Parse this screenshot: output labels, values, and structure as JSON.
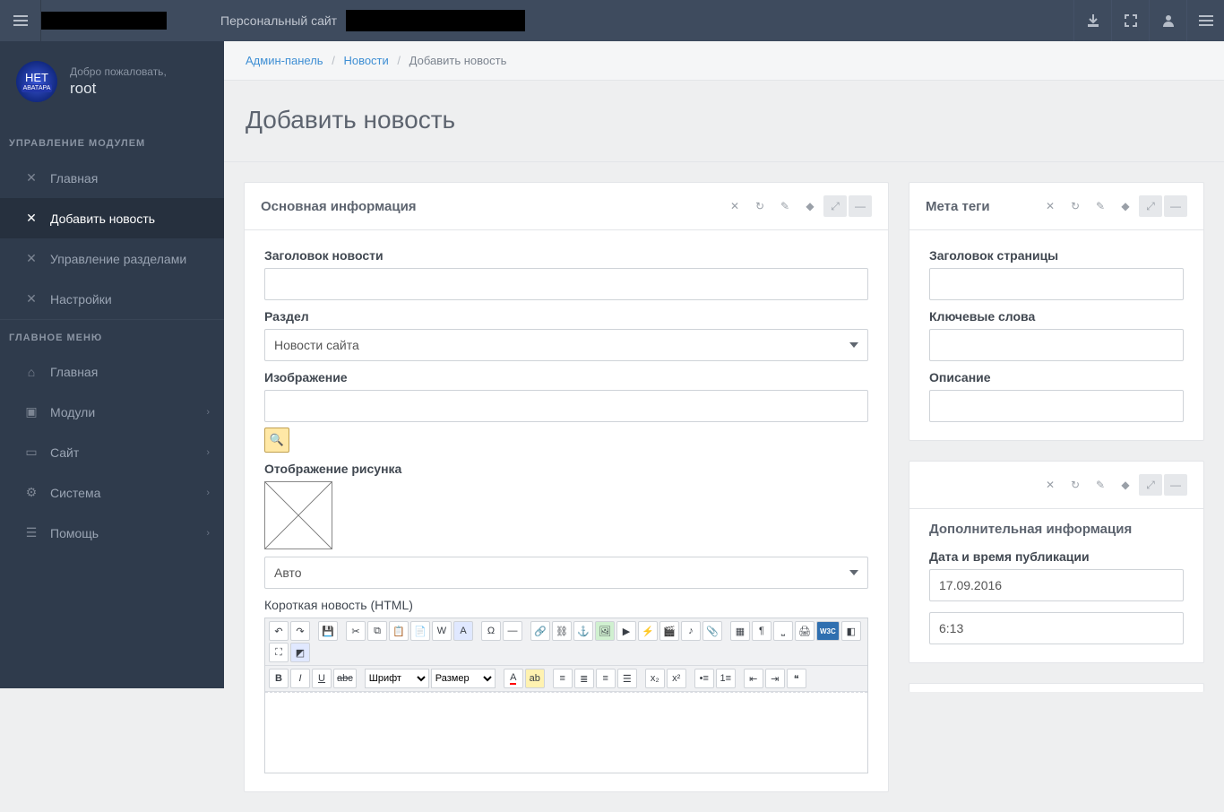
{
  "topbar": {
    "tagline": "Персональный сайт"
  },
  "avatar": {
    "line1": "НЕТ",
    "line2": "АВАТАРА"
  },
  "welcome": {
    "hello": "Добро пожаловать,",
    "user": "root"
  },
  "nav": {
    "section_module": "УПРАВЛЕНИЕ МОДУЛЕМ",
    "section_main": "ГЛАВНОЕ МЕНЮ",
    "module_items": [
      {
        "label": "Главная"
      },
      {
        "label": "Добавить новость"
      },
      {
        "label": "Управление разделами"
      },
      {
        "label": "Настройки"
      }
    ],
    "main_items": [
      {
        "label": "Главная"
      },
      {
        "label": "Модули"
      },
      {
        "label": "Сайт"
      },
      {
        "label": "Система"
      },
      {
        "label": "Помощь"
      }
    ]
  },
  "breadcrumb": {
    "admin": "Админ-панель",
    "news": "Новости",
    "current": "Добавить новость"
  },
  "page": {
    "title": "Добавить новость"
  },
  "panels": {
    "main": {
      "title": "Основная информация"
    },
    "meta": {
      "title": "Мета теги"
    },
    "extra": {
      "title": "Дополнительная информация"
    }
  },
  "fields": {
    "news_title": "Заголовок новости",
    "section": "Раздел",
    "section_value": "Новости сайта",
    "image": "Изображение",
    "image_display": "Отображение рисунка",
    "image_display_value": "Авто",
    "short_news": "Короткая новость (HTML)",
    "meta_title": "Заголовок страницы",
    "meta_keywords": "Ключевые слова",
    "meta_description": "Описание",
    "pub_datetime": "Дата и время публикации",
    "pub_date": "17.09.2016",
    "pub_time": "6:13"
  },
  "editor": {
    "font_label": "Шрифт",
    "size_label": "Размер"
  }
}
